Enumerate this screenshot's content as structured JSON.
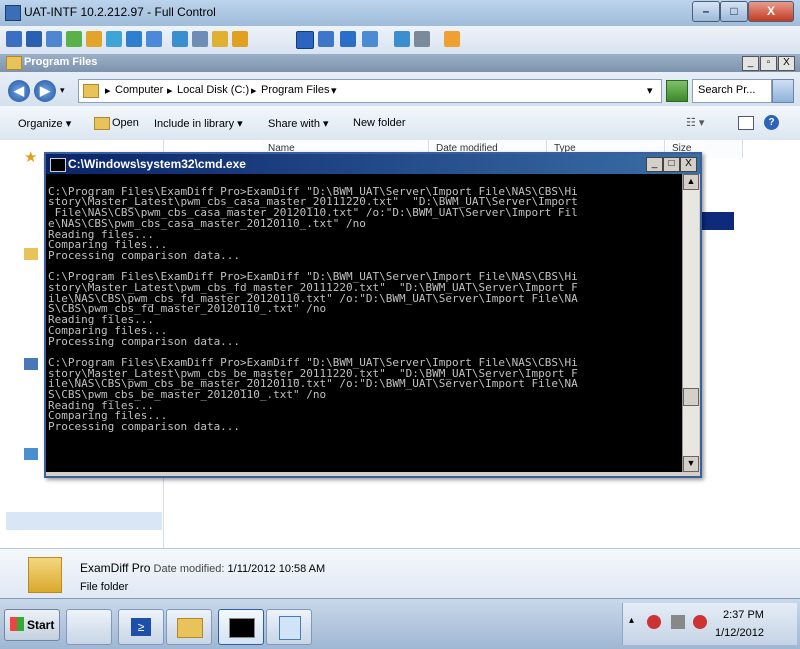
{
  "outer_window": {
    "title": "UAT-INTF 10.2.212.97 - Full Control",
    "minimize": "–",
    "maximize": "□",
    "close": "X"
  },
  "explorer": {
    "title": "Program Files",
    "title_buttons": [
      "_",
      "▫",
      "X"
    ],
    "breadcrumb": [
      "Computer",
      "Local Disk (C:)",
      "Program Files"
    ],
    "search_placeholder": "Search Pr...",
    "commands": [
      "Organize ▾",
      "Open",
      "Include in library ▾",
      "Share with ▾",
      "New folder"
    ],
    "columns": [
      "Name",
      "Date modified",
      "Type",
      "Size"
    ]
  },
  "details": {
    "name": "ExamDiff Pro",
    "date_label": "Date modified:",
    "date_value": "1/11/2012 10:58 AM",
    "type": "File folder"
  },
  "cmd": {
    "title": "C:\\Windows\\system32\\cmd.exe",
    "buttons": [
      "_",
      "□",
      "X"
    ],
    "lines": [
      "",
      "C:\\Program Files\\ExamDiff Pro>ExamDiff \"D:\\BWM_UAT\\Server\\Import File\\NAS\\CBS\\Hi",
      "story\\Master_Latest\\pwm_cbs_casa_master_20111220.txt\"  \"D:\\BWM_UAT\\Server\\Import",
      " File\\NAS\\CBS\\pwm_cbs_casa_master_20120110.txt\" /o:\"D:\\BWM_UAT\\Server\\Import Fil",
      "e\\NAS\\CBS\\pwm_cbs_casa_master_20120110_.txt\" /no",
      "Reading files...",
      "Comparing files...",
      "Processing comparison data...",
      "",
      "C:\\Program Files\\ExamDiff Pro>ExamDiff \"D:\\BWM_UAT\\Server\\Import File\\NAS\\CBS\\Hi",
      "story\\Master_Latest\\pwm_cbs_fd_master_20111220.txt\"  \"D:\\BWM_UAT\\Server\\Import F",
      "ile\\NAS\\CBS\\pwm_cbs_fd_master_20120110.txt\" /o:\"D:\\BWM_UAT\\Server\\Import File\\NA",
      "S\\CBS\\pwm_cbs_fd_master_20120110_.txt\" /no",
      "Reading files...",
      "Comparing files...",
      "Processing comparison data...",
      "",
      "C:\\Program Files\\ExamDiff Pro>ExamDiff \"D:\\BWM_UAT\\Server\\Import File\\NAS\\CBS\\Hi",
      "story\\Master_Latest\\pwm_cbs_be_master_20111220.txt\"  \"D:\\BWM_UAT\\Server\\Import F",
      "ile\\NAS\\CBS\\pwm_cbs_be_master_20120110.txt\" /o:\"D:\\BWM_UAT\\Server\\Import File\\NA",
      "S\\CBS\\pwm_cbs_be_master_20120110_.txt\" /no",
      "Reading files...",
      "Comparing files...",
      "Processing comparison data..."
    ]
  },
  "taskbar": {
    "start": "Start",
    "time": "2:37 PM",
    "date": "1/12/2012"
  }
}
